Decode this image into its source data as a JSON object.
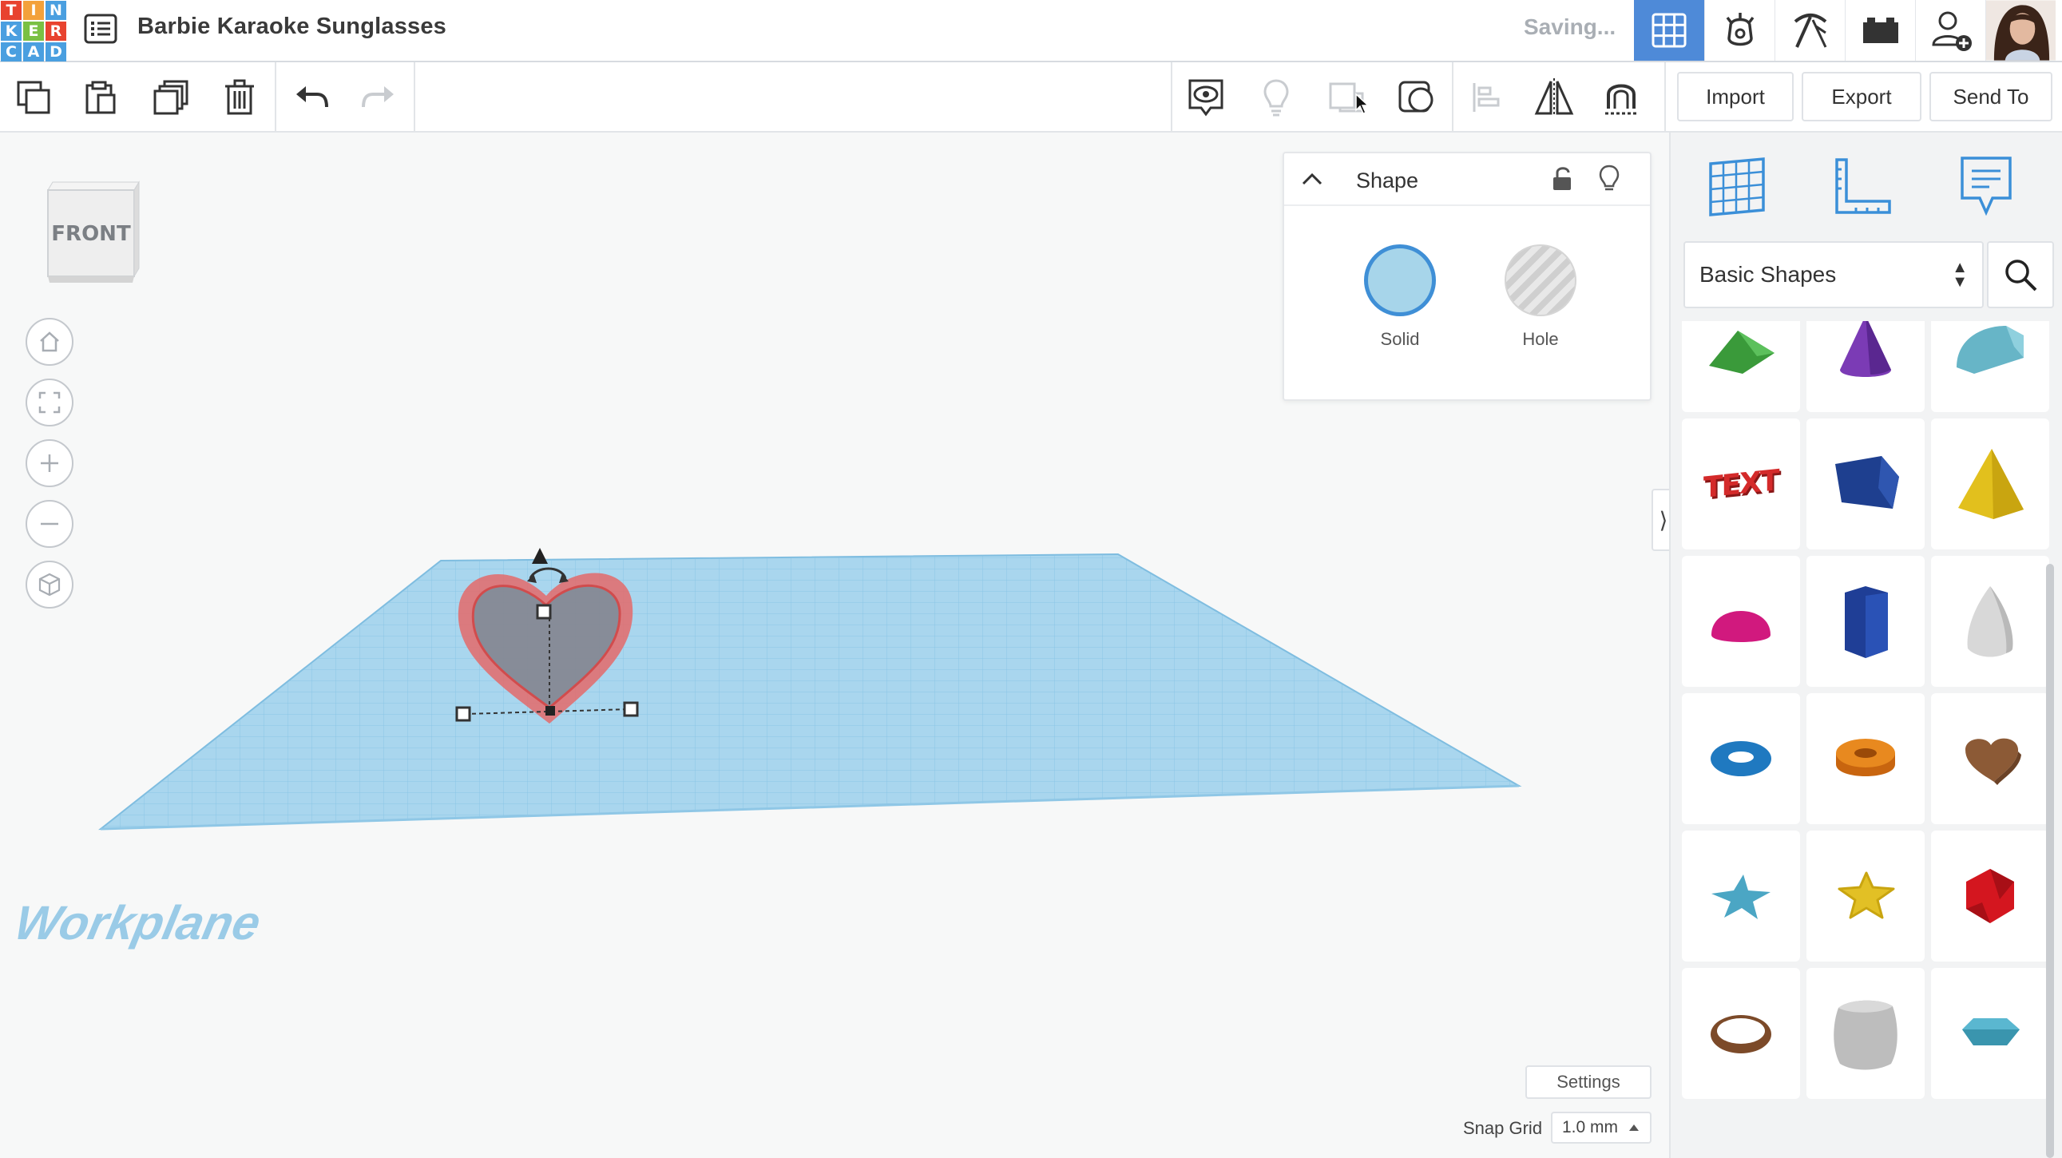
{
  "app": {
    "logo_letters": [
      "T",
      "I",
      "N",
      "K",
      "E",
      "R",
      "C",
      "A",
      "D"
    ],
    "project_title": "Barbie Karaoke Sunglasses",
    "save_status": "Saving..."
  },
  "toolbar": {
    "import_label": "Import",
    "export_label": "Export",
    "send_to_label": "Send To"
  },
  "viewcube": {
    "face_label": "FRONT"
  },
  "workplane": {
    "label": "Workplane"
  },
  "inspector": {
    "title": "Shape",
    "solid_label": "Solid",
    "hole_label": "Hole"
  },
  "canvas_footer": {
    "settings_label": "Settings",
    "snap_grid_label": "Snap Grid",
    "snap_grid_value": "1.0 mm"
  },
  "library": {
    "selected": "Basic Shapes",
    "shape_text_preview": "TEXT"
  },
  "colors": {
    "accent": "#4e8ad8",
    "workplane": "#a9d6ee",
    "selection_outline": "#e04848"
  }
}
